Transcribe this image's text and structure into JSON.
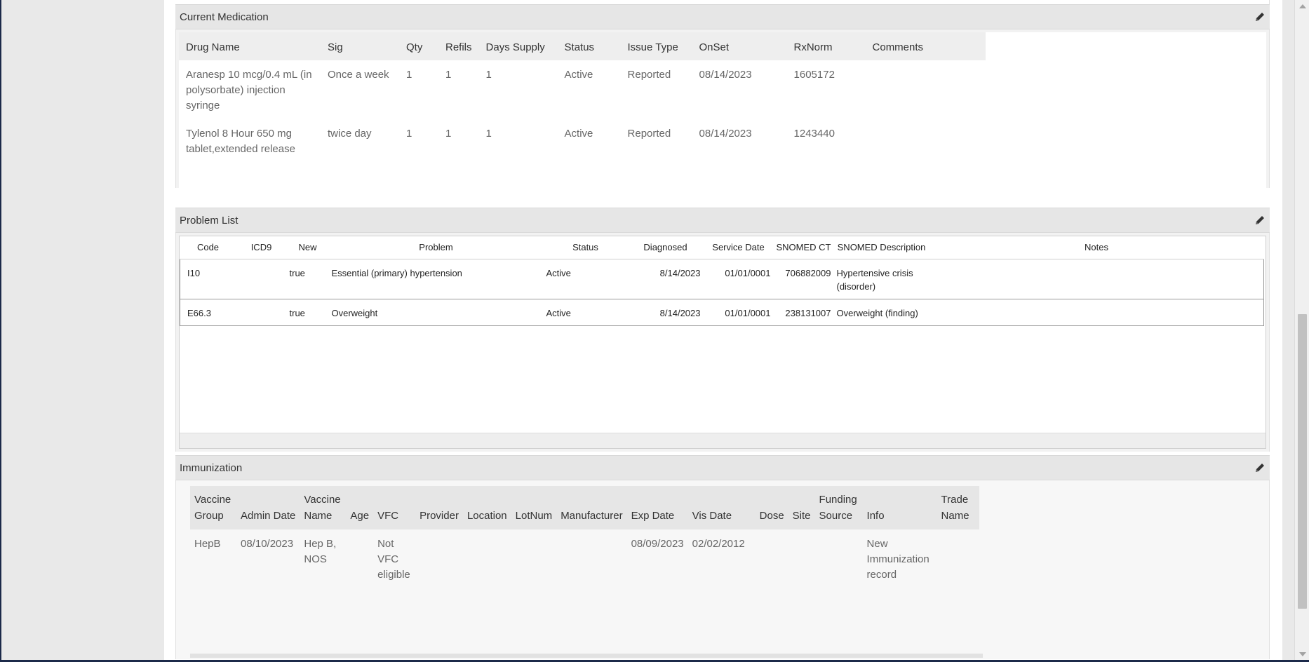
{
  "medication": {
    "title": "Current Medication",
    "columns": [
      "Drug Name",
      "Sig",
      "Qty",
      "Refils",
      "Days Supply",
      "Status",
      "Issue Type",
      "OnSet",
      "RxNorm",
      "Comments"
    ],
    "rows": [
      {
        "drug": "Aranesp 10 mcg/0.4 mL (in polysorbate) injection syringe",
        "sig": "Once a week",
        "qty": "1",
        "refils": "1",
        "days": "1",
        "status": "Active",
        "issue": "Reported",
        "onset": "08/14/2023",
        "rxnorm": "1605172",
        "comments": ""
      },
      {
        "drug": "Tylenol 8 Hour 650 mg tablet,extended release",
        "sig": "twice day",
        "qty": "1",
        "refils": "1",
        "days": "1",
        "status": "Active",
        "issue": "Reported",
        "onset": "08/14/2023",
        "rxnorm": "1243440",
        "comments": ""
      }
    ]
  },
  "problems": {
    "title": "Problem List",
    "columns": [
      "Code",
      "ICD9",
      "New",
      "Problem",
      "Status",
      "Diagnosed",
      "Service Date",
      "SNOMED CT",
      "SNOMED Description",
      "Notes"
    ],
    "rows": [
      {
        "code": "I10",
        "icd9": "",
        "new": "true",
        "problem": "Essential (primary) hypertension",
        "status": "Active",
        "diagnosed": "8/14/2023",
        "service": "01/01/0001",
        "snomed": "706882009",
        "desc": "Hypertensive crisis (disorder)",
        "notes": ""
      },
      {
        "code": "E66.3",
        "icd9": "",
        "new": "true",
        "problem": "Overweight",
        "status": "Active",
        "diagnosed": "8/14/2023",
        "service": "01/01/0001",
        "snomed": "238131007",
        "desc": "Overweight (finding)",
        "notes": ""
      }
    ]
  },
  "immunization": {
    "title": "Immunization",
    "columns": [
      "Vaccine Group",
      "Admin Date",
      "Vaccine Name",
      "Age",
      "VFC",
      "Provider",
      "Location",
      "LotNum",
      "Manufacturer",
      "Exp Date",
      "Vis Date",
      "Dose",
      "Site",
      "Funding Source",
      "Info",
      "Trade Name"
    ],
    "rows": [
      {
        "group": "HepB",
        "admin": "08/10/2023",
        "name": "Hep B, NOS",
        "age": "",
        "vfc": "Not VFC eligible",
        "provider": "",
        "location": "",
        "lot": "",
        "manufacturer": "",
        "exp": "08/09/2023",
        "vis": "02/02/2012",
        "dose": "",
        "site": "",
        "funding": "",
        "info": "New Immunization record",
        "trade": ""
      }
    ]
  },
  "icons": {
    "edit": "pencil-icon"
  }
}
